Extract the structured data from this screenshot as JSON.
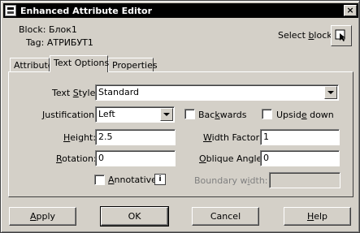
{
  "window": {
    "title": "Enhanced Attribute Editor",
    "close_glyph": "×"
  },
  "header": {
    "block_label": "Block: Блок1",
    "tag_label": "Tag: АТРИБУТ1",
    "select_block_prefix": "Select ",
    "select_block_u": "b",
    "select_block_suffix": "lock"
  },
  "tabs": [
    {
      "label": "Attribute",
      "active": false
    },
    {
      "label": "Text Options",
      "active": true
    },
    {
      "label": "Properties",
      "active": false
    }
  ],
  "text_options": {
    "text_style": {
      "label_u": "S",
      "label_pre": "Text ",
      "label_post": "tyle:",
      "value": "Standard"
    },
    "justification": {
      "label_u": "J",
      "label_post": "ustification:",
      "value": "Left"
    },
    "backwards": {
      "label_u": "k",
      "label_pre": "Bac",
      "label_post": "wards",
      "checked": false
    },
    "upside_down": {
      "label_u": "e",
      "label_pre": "Upsid",
      "label_post": " down",
      "checked": false
    },
    "height": {
      "label_u": "H",
      "label_post": "eight:",
      "value": "2.5"
    },
    "width_factor": {
      "label_u": "W",
      "label_post": "idth Factor:",
      "value": "1"
    },
    "rotation": {
      "label_u": "R",
      "label_post": "otation:",
      "value": "0"
    },
    "oblique_angle": {
      "label_u": "O",
      "label_post": "blique Angle:",
      "value": "0"
    },
    "annotative": {
      "label_u": "A",
      "label_post": "nnotative",
      "checked": false,
      "info_glyph": "i"
    },
    "boundary_width": {
      "label_pre": "Boundary w",
      "label_u": "i",
      "label_post": "dth:",
      "value": "",
      "enabled": false
    }
  },
  "footer": {
    "apply": {
      "u": "A",
      "rest": "pply"
    },
    "ok": "OK",
    "cancel": "Cancel",
    "help": {
      "u": "H",
      "rest": "elp"
    }
  }
}
